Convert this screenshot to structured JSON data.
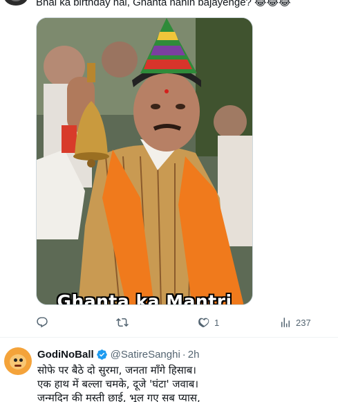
{
  "tweet1": {
    "text": "Bhai ka birthday hai, Ghanta nahin bajayenge? 😂😂😂",
    "media_caption": "Ghanta ka Mantri",
    "actions": {
      "reply": {
        "icon": "reply-icon",
        "count": ""
      },
      "retweet": {
        "icon": "retweet-icon",
        "count": ""
      },
      "like": {
        "icon": "heart-icon",
        "count": "1"
      },
      "views": {
        "icon": "views-icon",
        "count": "237"
      }
    }
  },
  "tweet2": {
    "display_name": "GodiNoBall",
    "handle": "@SatireSanghi",
    "separator": "·",
    "time": "2h",
    "verified_color": "#1d9bf0",
    "lines": [
      "सोफे पर बैठे दो सुरमा, जनता माँगे हिसाब।",
      "एक हाथ में बल्ला चमके, दूजे 'घंटा' जवाब।",
      "जन्मदिन की मस्ती छाई, भूल गए सब प्यास,"
    ]
  }
}
